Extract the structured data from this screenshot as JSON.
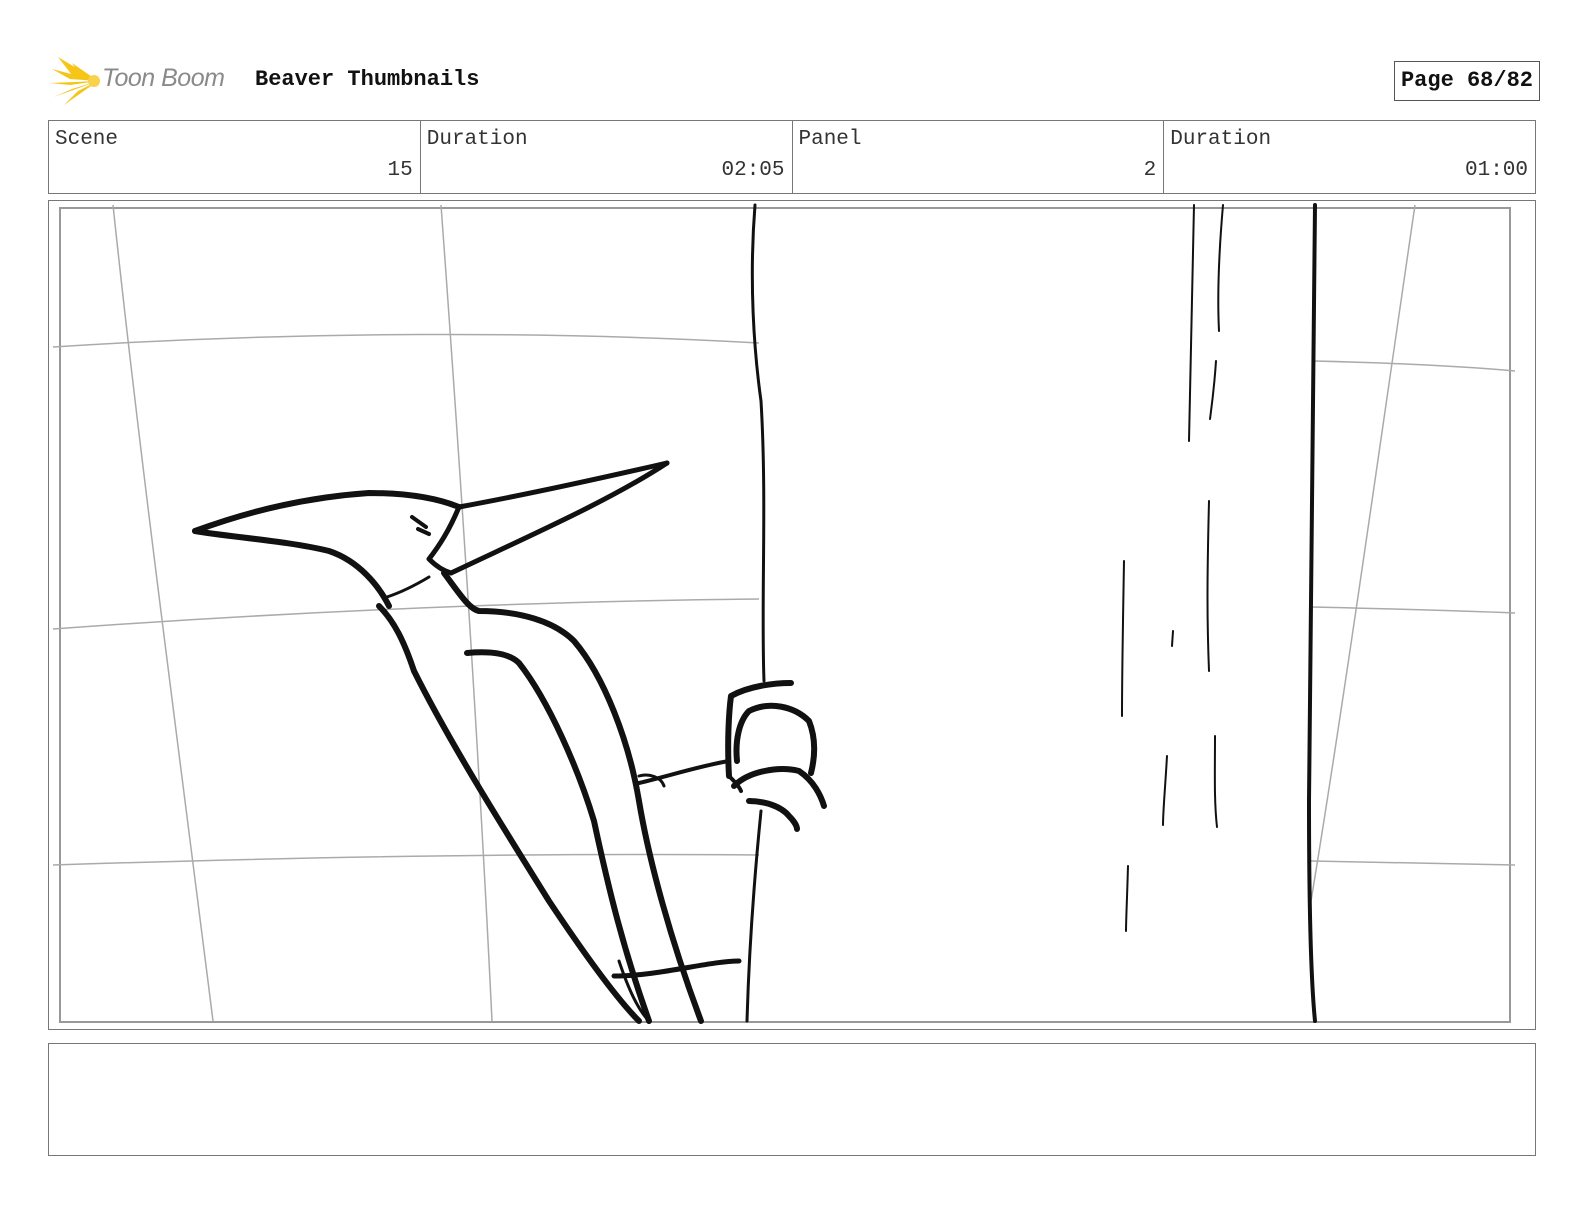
{
  "header": {
    "logo_text": "Toon Boom",
    "logo_icon": "starburst-icon",
    "title": "Beaver Thumbnails",
    "page": "Page 68/82"
  },
  "info": {
    "scene_label": "Scene",
    "scene_value": "15",
    "scene_duration_label": "Duration",
    "scene_duration_value": "02:05",
    "panel_label": "Panel",
    "panel_value": "2",
    "panel_duration_label": "Duration",
    "panel_duration_value": "01:00"
  },
  "colors": {
    "logo_accent": "#f5c518",
    "logo_text": "#8a8a8a",
    "border": "#777777"
  }
}
